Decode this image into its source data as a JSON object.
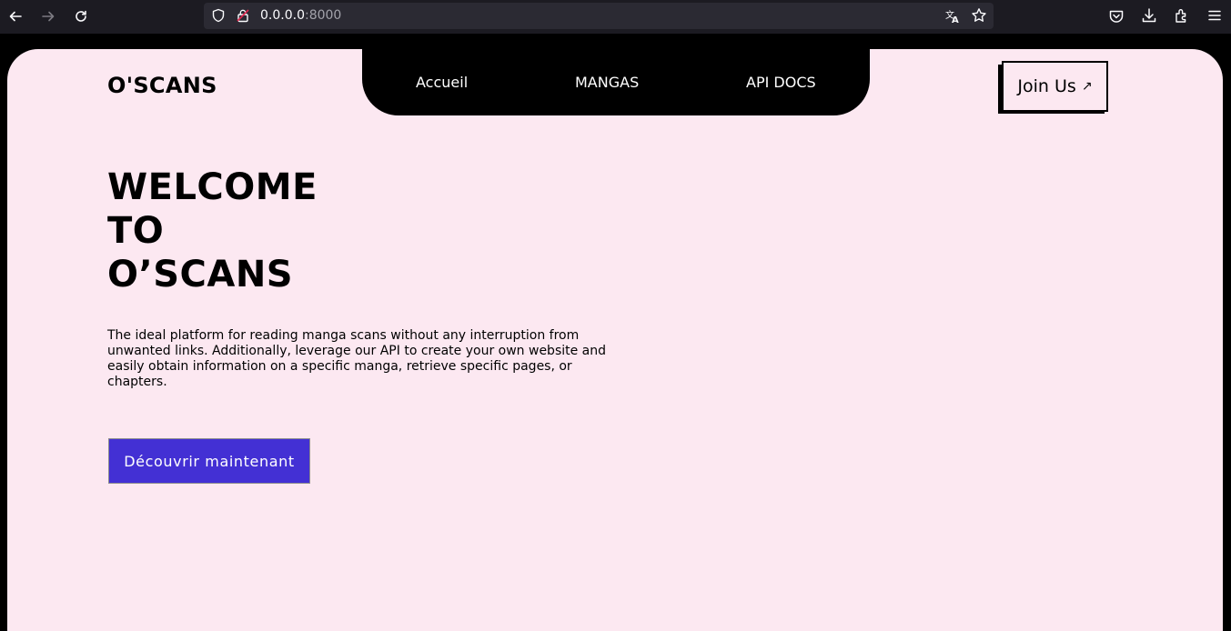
{
  "browser": {
    "url_host": "0.0.0.0",
    "url_port": ":8000"
  },
  "site": {
    "logo": "O'SCANS",
    "nav": [
      "Accueil",
      "MANGAS",
      "API DOCS"
    ],
    "join_label": "Join Us",
    "join_arrow": "↗"
  },
  "hero": {
    "title_lines": [
      "WELCOME",
      "TO",
      "O’SCANS"
    ],
    "description": "The ideal platform for reading manga scans without any interruption from unwanted links. Additionally, leverage our API to create your own website and easily obtain information on a specific manga, retrieve specific pages, or chapters.",
    "cta_label": "Découvrir maintenant"
  },
  "colors": {
    "page_bg": "#fce8f1",
    "cta_bg": "#4330d4",
    "nav_bg": "#000000"
  }
}
